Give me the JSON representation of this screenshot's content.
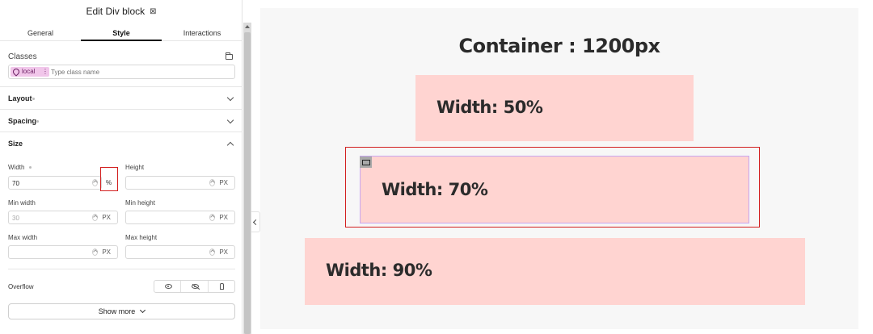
{
  "panel": {
    "title": "Edit Div block",
    "tabs": [
      {
        "label": "General",
        "active": false
      },
      {
        "label": "Style",
        "active": true
      },
      {
        "label": "Interactions",
        "active": false
      }
    ],
    "classes": {
      "label": "Classes",
      "chip": "local",
      "placeholder": "Type class name"
    },
    "sections": {
      "layout": "Layout",
      "spacing": "Spacing",
      "size": "Size"
    },
    "size": {
      "width": {
        "label": "Width",
        "value": "70",
        "unit": "%"
      },
      "height": {
        "label": "Height",
        "value": "",
        "unit": "PX"
      },
      "min_width": {
        "label": "Min width",
        "placeholder": "30",
        "unit": "PX"
      },
      "min_height": {
        "label": "Min height",
        "value": "",
        "unit": "PX"
      },
      "max_width": {
        "label": "Max width",
        "value": "",
        "unit": "PX"
      },
      "max_height": {
        "label": "Max height",
        "value": "",
        "unit": "PX"
      }
    },
    "overflow": {
      "label": "Overflow"
    },
    "show_more": "Show more"
  },
  "canvas": {
    "container_title": "Container : 1200px",
    "boxes": [
      {
        "label": "Width: 50%",
        "width_percent": 50
      },
      {
        "label": "Width: 70%",
        "width_percent": 70
      },
      {
        "label": "Width: 90%",
        "width_percent": 90
      }
    ],
    "box_color": "#ffd4d1",
    "highlight_color": "#d21f1f"
  }
}
